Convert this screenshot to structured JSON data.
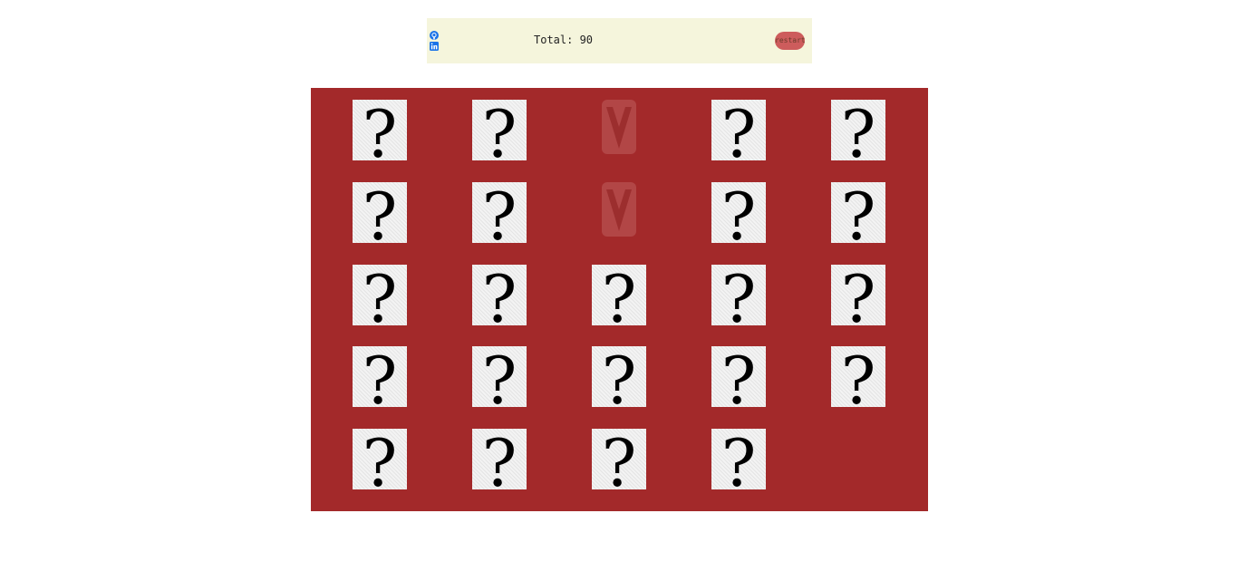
{
  "header": {
    "total_label": "Total: 90",
    "restart_label": "restart",
    "social_icons": [
      "github-icon",
      "linkedin-icon"
    ]
  },
  "board": {
    "rows": 5,
    "columns": 5,
    "cards": [
      {
        "state": "hidden",
        "face": "?"
      },
      {
        "state": "hidden",
        "face": "?"
      },
      {
        "state": "matched",
        "face": "vue-logo-icon"
      },
      {
        "state": "hidden",
        "face": "?"
      },
      {
        "state": "hidden",
        "face": "?"
      },
      {
        "state": "hidden",
        "face": "?"
      },
      {
        "state": "hidden",
        "face": "?"
      },
      {
        "state": "matched",
        "face": "vue-logo-icon"
      },
      {
        "state": "hidden",
        "face": "?"
      },
      {
        "state": "hidden",
        "face": "?"
      },
      {
        "state": "hidden",
        "face": "?"
      },
      {
        "state": "hidden",
        "face": "?"
      },
      {
        "state": "hidden",
        "face": "?"
      },
      {
        "state": "hidden",
        "face": "?"
      },
      {
        "state": "hidden",
        "face": "?"
      },
      {
        "state": "hidden",
        "face": "?"
      },
      {
        "state": "hidden",
        "face": "?"
      },
      {
        "state": "hidden",
        "face": "?"
      },
      {
        "state": "hidden",
        "face": "?"
      },
      {
        "state": "hidden",
        "face": "?"
      },
      {
        "state": "hidden",
        "face": "?"
      },
      {
        "state": "hidden",
        "face": "?"
      },
      {
        "state": "hidden",
        "face": "?"
      },
      {
        "state": "hidden",
        "face": "?"
      }
    ]
  },
  "colors": {
    "header_bg": "#f5f5dc",
    "board_bg": "#a3292a",
    "restart_bg": "#cd5c5c",
    "icon_blue": "#1a73e8"
  }
}
